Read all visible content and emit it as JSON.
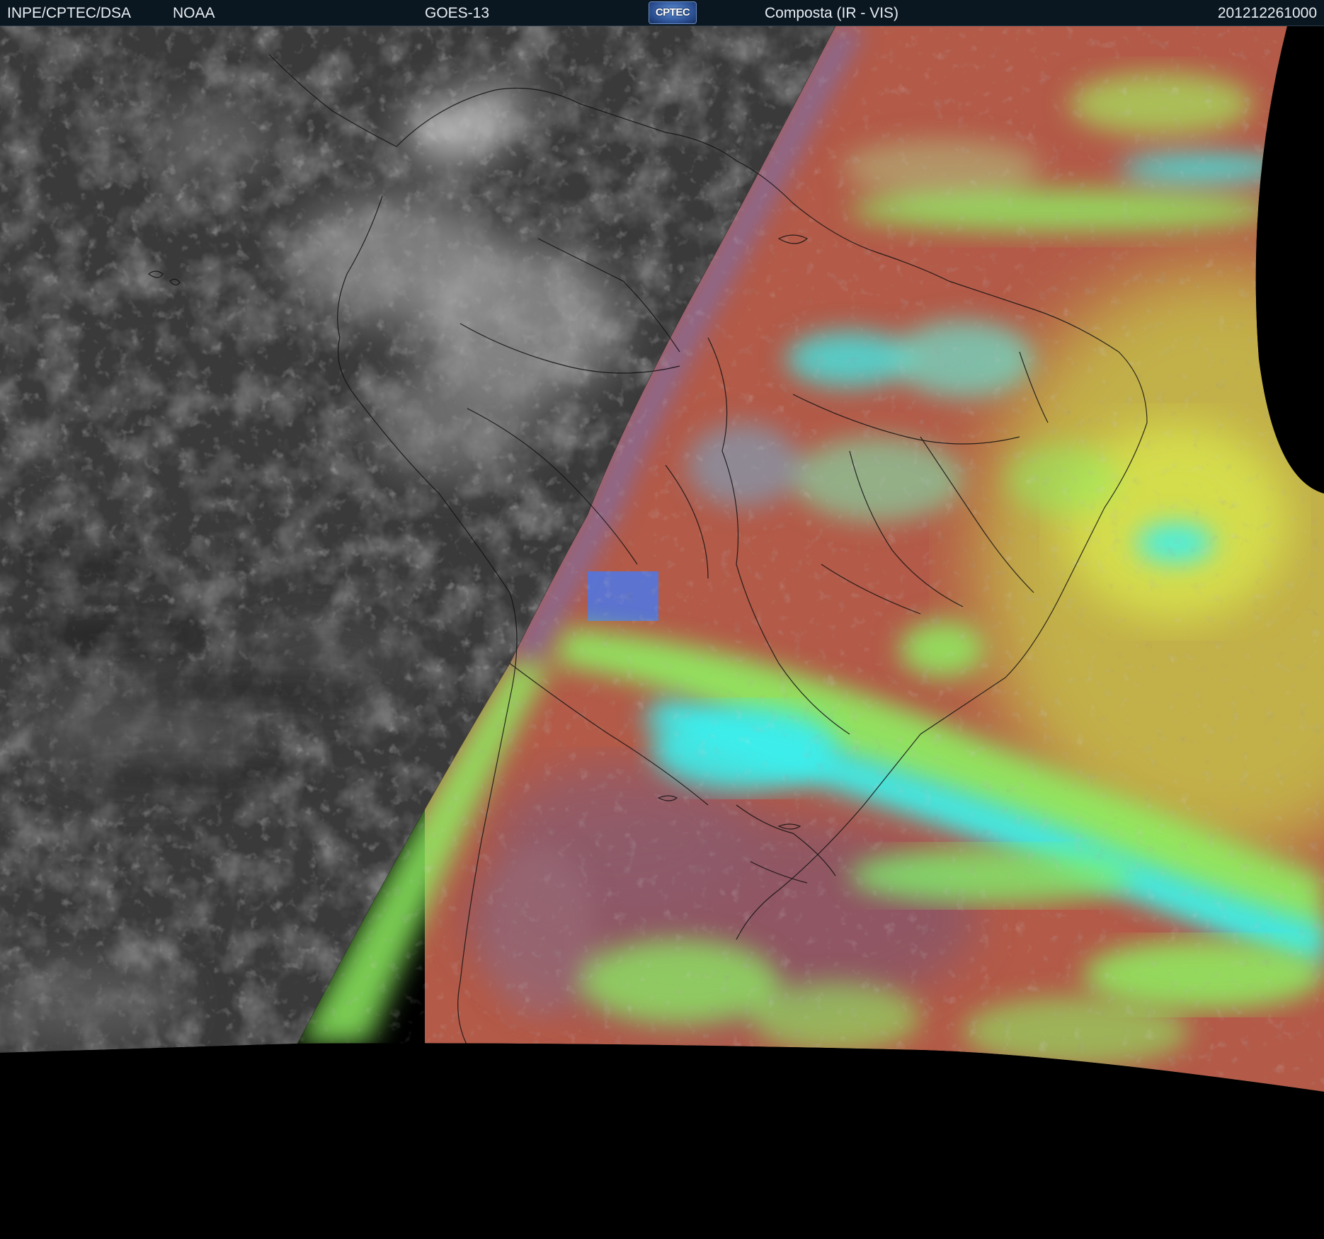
{
  "header": {
    "organization": "INPE/CPTEC/DSA",
    "agency": "NOAA",
    "satellite": "GOES-13",
    "logo_text": "CPTEC",
    "product": "Composta (IR - VIS)",
    "timestamp": "201212261000"
  },
  "colors": {
    "header_bg": "#0a1620",
    "night_ir_gray": "#3a3a3a",
    "day_land_red": "#b35a48",
    "low_cloud_green": "#8fef62",
    "high_cloud_cyan": "#3af0ee",
    "ocean_yellow": "#c9c34a",
    "space_black": "#000000"
  }
}
